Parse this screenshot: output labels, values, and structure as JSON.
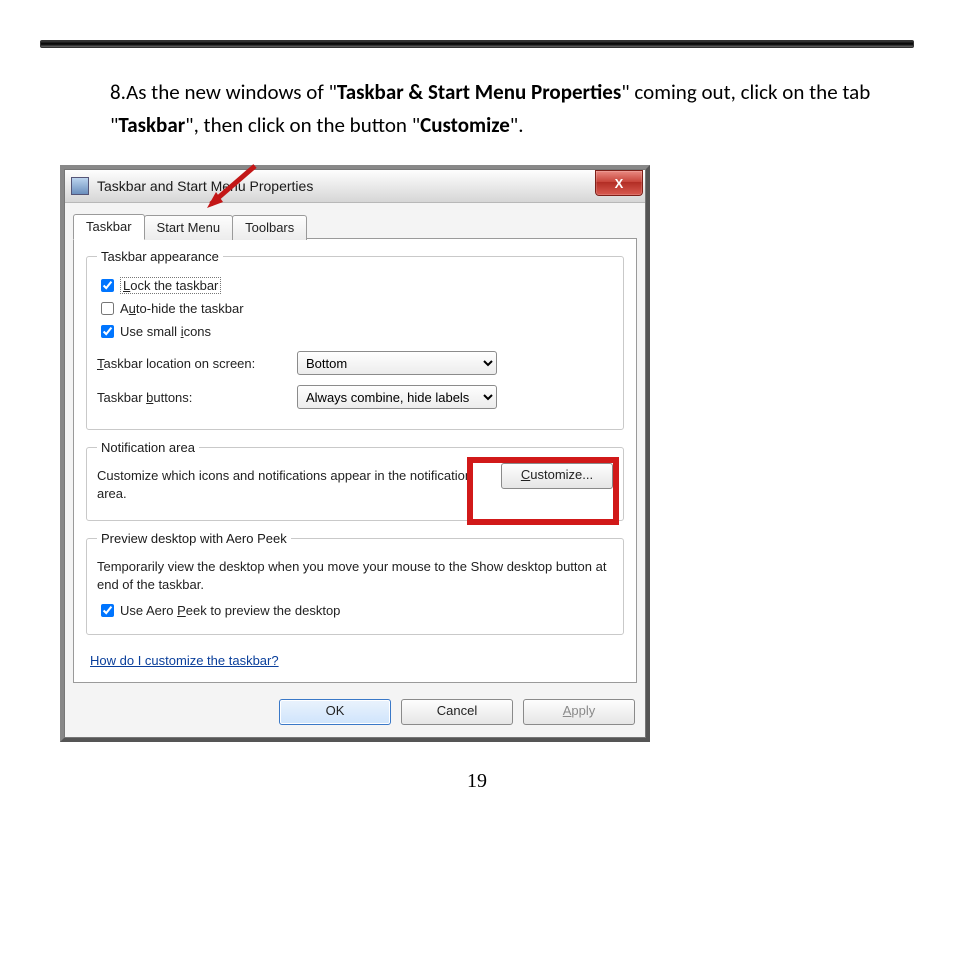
{
  "instruction": {
    "prefix": "8.As the new windows of \"",
    "bold1": "Taskbar & Start Menu Properties",
    "mid1": "\" coming out, click on the tab \"",
    "bold2": "Taskbar",
    "mid2": "\", then click on the button \"",
    "bold3": "Customize",
    "suffix": "\"."
  },
  "window": {
    "title": "Taskbar and Start Menu Properties",
    "close": "X",
    "tabs": {
      "taskbar": "Taskbar",
      "startmenu": "Start Menu",
      "toolbars": "Toolbars"
    }
  },
  "appearance": {
    "legend": "Taskbar appearance",
    "lock_pre": "",
    "lock_key": "L",
    "lock_post": "ock the taskbar",
    "auto_pre": "A",
    "auto_key": "u",
    "auto_post": "to-hide the taskbar",
    "small_pre": "Use small ",
    "small_key": "i",
    "small_post": "cons",
    "location_label_pre": "",
    "location_label_key": "T",
    "location_label_post": "askbar location on screen:",
    "location_value": "Bottom",
    "buttons_label_pre": "Taskbar ",
    "buttons_label_key": "b",
    "buttons_label_post": "uttons:",
    "buttons_value": "Always combine, hide labels"
  },
  "notification": {
    "legend": "Notification area",
    "desc": "Customize which icons and notifications appear in the notification area.",
    "button_pre": "",
    "button_key": "C",
    "button_post": "ustomize..."
  },
  "aero": {
    "legend": "Preview desktop with Aero Peek",
    "desc": "Temporarily view the desktop when you move your mouse to the Show desktop button at end of the taskbar.",
    "chk_pre": "Use Aero ",
    "chk_key": "P",
    "chk_post": "eek to preview the desktop"
  },
  "help_link": "How do I customize the taskbar?",
  "footer": {
    "ok": "OK",
    "cancel": "Cancel",
    "apply_pre": "",
    "apply_key": "A",
    "apply_post": "pply"
  },
  "page_number": "19"
}
